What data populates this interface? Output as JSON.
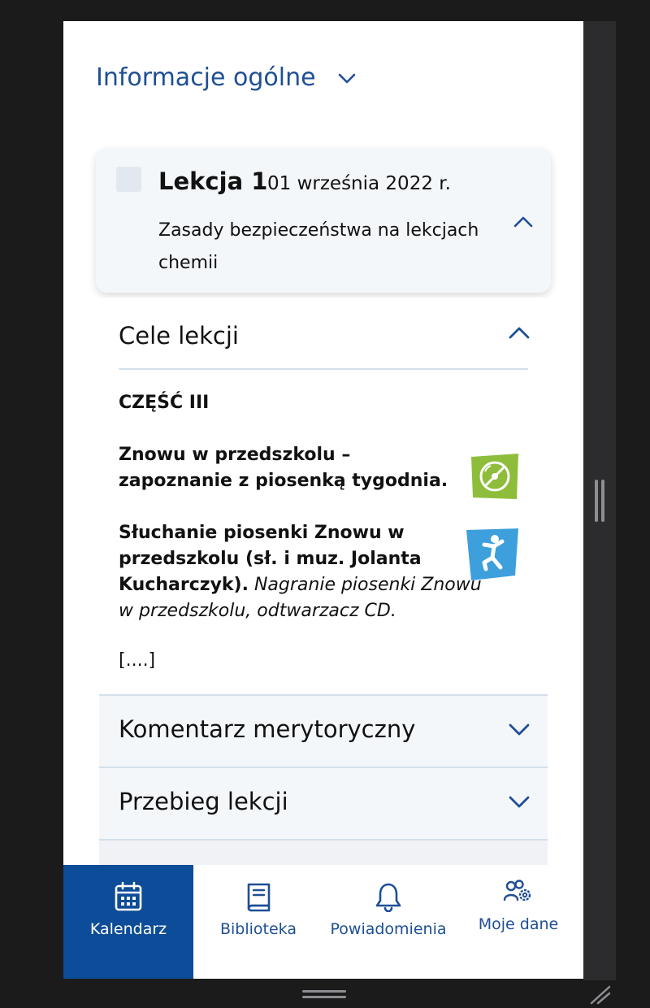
{
  "section": {
    "title": "Informacje ogólne"
  },
  "lesson": {
    "title": "Lekcja 1",
    "date": "01 września 2022 r.",
    "subject": "Zasady bezpieczeństwa na lekcjach chemii"
  },
  "accordion": {
    "open_section": {
      "title": "Cele lekcji",
      "part": "CZĘŚĆ III",
      "paragraph1": "Znowu w przedszkolu – zapoznanie z piosenką tygodnia.",
      "paragraph2_bold": "Słuchanie piosenki Znowu w przedszkolu (sł. i muz. Jolanta Kucharczyk).",
      "paragraph2_italic": "Nagranie piosenki Znowu w przedszkolu, odtwarzacz CD.",
      "ellipsis": "[....]"
    },
    "collapsed": [
      {
        "title": "Komentarz merytoryczny"
      },
      {
        "title": "Przebieg lekcji"
      }
    ]
  },
  "nav": {
    "items": [
      {
        "label": "Kalendarz",
        "icon": "calendar-icon",
        "active": true
      },
      {
        "label": "Biblioteka",
        "icon": "book-icon"
      },
      {
        "label": "Powiadomienia",
        "icon": "bell-icon"
      },
      {
        "label": "Moje dane",
        "icon": "user-settings-icon"
      }
    ]
  },
  "colors": {
    "accent": "#1f4f96",
    "nav_active": "#0d4c98",
    "card_bg": "#f4f7fa",
    "icon_green": "#8dbd3a",
    "icon_blue": "#3d9fdc"
  }
}
